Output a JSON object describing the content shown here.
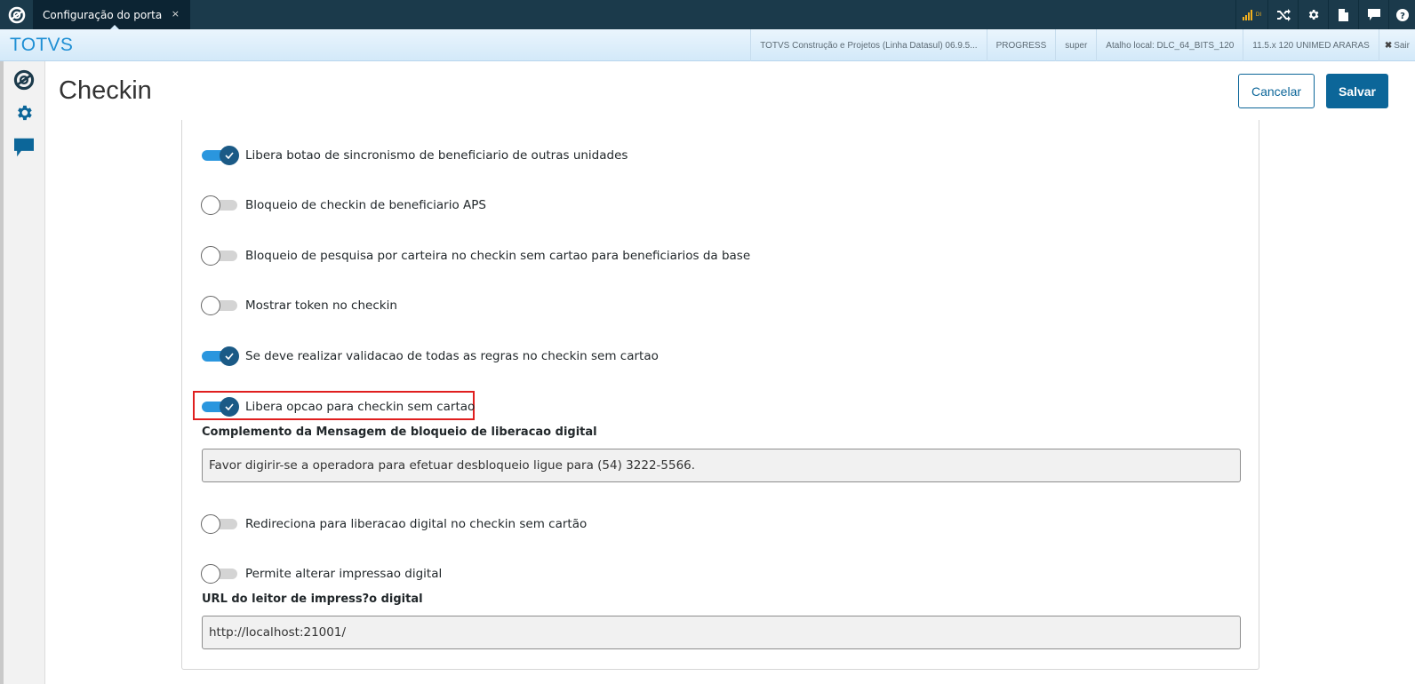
{
  "topbar": {
    "tab_title": "Configuração do porta",
    "tab_close": "×",
    "signal_label": "DI",
    "icons": [
      "totvs-logo-icon",
      "signal-icon",
      "shuffle-icon",
      "gear-icon",
      "document-icon",
      "chat-icon",
      "help-icon"
    ]
  },
  "infobar": {
    "brand": "TOTVS",
    "items": [
      "TOTVS Construção e Projetos (Linha Datasul) 06.9.5...",
      "PROGRESS",
      "super",
      "Atalho local: DLC_64_BITS_120",
      "11.5.x 120 UNIMED ARARAS"
    ],
    "exit_label": "Sair"
  },
  "sidebar": {
    "icons": [
      "totvs-logo-icon",
      "gear-icon",
      "chat-icon"
    ]
  },
  "page": {
    "title": "Checkin",
    "cancel_label": "Cancelar",
    "save_label": "Salvar"
  },
  "settings": [
    {
      "label": "Libera botao de sincronismo de beneficiario de outras unidades",
      "on": true
    },
    {
      "label": "Bloqueio de checkin de beneficiario APS",
      "on": false
    },
    {
      "label": "Bloqueio de pesquisa por carteira no checkin sem cartao para beneficiarios da base",
      "on": false
    },
    {
      "label": "Mostrar token no checkin",
      "on": false
    },
    {
      "label": "Se deve realizar validacao de todas as regras no checkin sem cartao",
      "on": true
    },
    {
      "label": "Libera opcao para checkin sem cartao",
      "on": true
    },
    {
      "label": "Redireciona para liberacao digital no checkin sem cartão",
      "on": false
    },
    {
      "label": "Permite alterar impressao digital",
      "on": false
    }
  ],
  "fields": {
    "message_label": "Complemento da Mensagem de bloqueio de liberacao digital",
    "message_value": "Favor digirir-se a operadora para efetuar desbloqueio ligue para (54) 3222-5566.",
    "url_label": "URL do leitor de impress?o digital",
    "url_value": "http://localhost:21001/"
  },
  "colors": {
    "topbar": "#1b3a4b",
    "accent": "#0c6699",
    "switch_on": "#2a96de",
    "highlight": "#e01f1f"
  }
}
